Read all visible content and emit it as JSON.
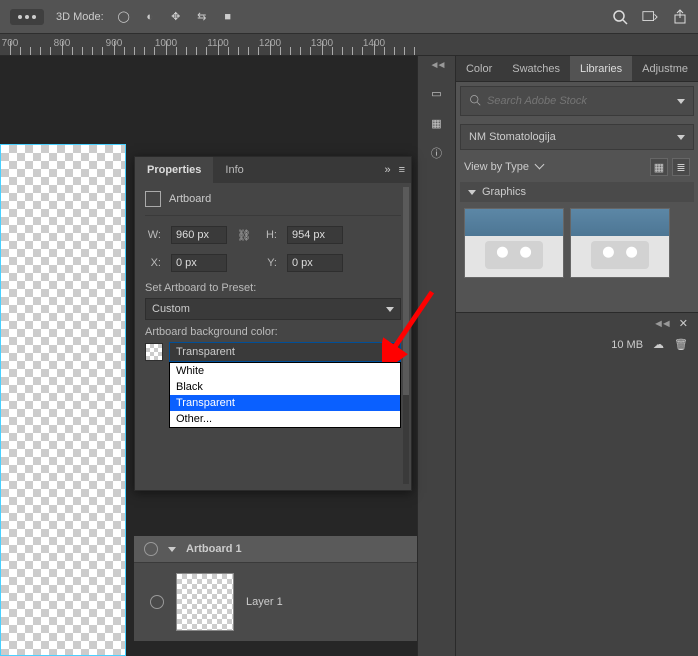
{
  "topbar": {
    "mode_label": "3D Mode:"
  },
  "ruler": {
    "marks": [
      700,
      800,
      900,
      1000,
      1100,
      1200,
      1300,
      1400
    ]
  },
  "properties": {
    "tabs": {
      "properties": "Properties",
      "info": "Info"
    },
    "artboard_label": "Artboard",
    "w_label": "W:",
    "w_value": "960 px",
    "h_label": "H:",
    "h_value": "954 px",
    "x_label": "X:",
    "x_value": "0 px",
    "y_label": "Y:",
    "y_value": "0 px",
    "preset_label": "Set Artboard to Preset:",
    "preset_value": "Custom",
    "bg_label": "Artboard background color:",
    "bg_value": "Transparent",
    "bg_options": [
      "White",
      "Black",
      "Transparent",
      "Other..."
    ],
    "more": "»"
  },
  "layers": {
    "artboard_name": "Artboard 1",
    "layer_name": "Layer 1"
  },
  "libraries": {
    "tabs": {
      "color": "Color",
      "swatches": "Swatches",
      "libraries": "Libraries",
      "adjustme": "Adjustme"
    },
    "search_placeholder": "Search Adobe Stock",
    "lib_name": "NM Stomatologija",
    "view_label": "View by Type",
    "section": "Graphics",
    "status_size": "10 MB"
  }
}
